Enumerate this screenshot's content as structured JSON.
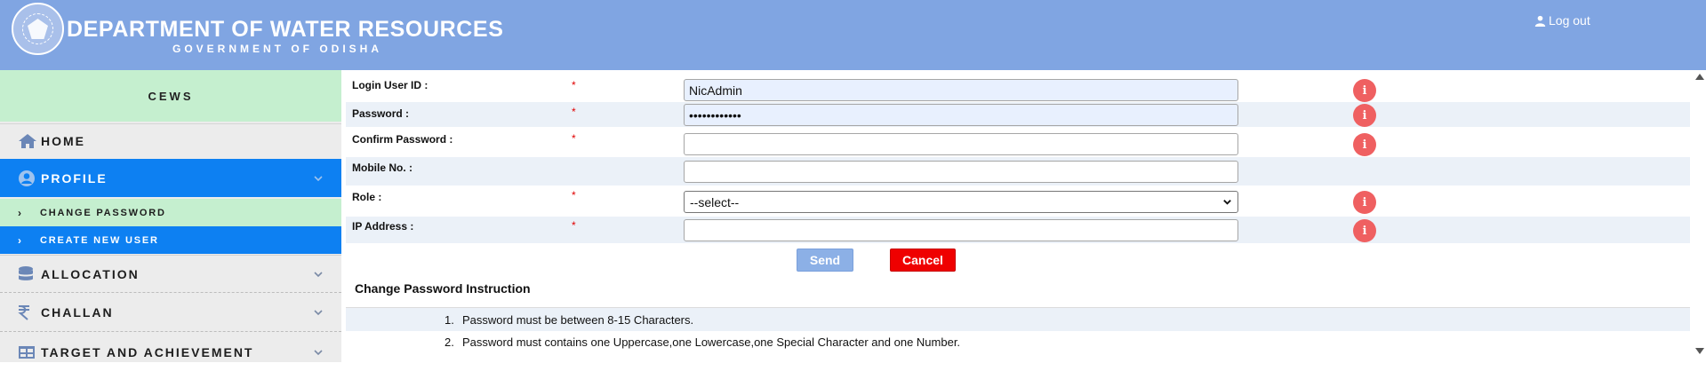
{
  "header": {
    "title": "DEPARTMENT OF WATER RESOURCES",
    "subtitle": "GOVERNMENT OF ODISHA",
    "logout_label": "Log out"
  },
  "sidebar": {
    "brand": "CEWS",
    "items": [
      {
        "label": "HOME",
        "icon": "home-icon"
      },
      {
        "label": "PROFILE",
        "icon": "user-circle-icon",
        "active": true
      },
      {
        "label": "ALLOCATION",
        "icon": "database-icon"
      },
      {
        "label": "CHALLAN",
        "icon": "rupee-icon"
      },
      {
        "label": "TARGET AND ACHIEVEMENT",
        "icon": "table-icon"
      }
    ],
    "profile_sub": [
      {
        "arrow": "›",
        "label": "CHANGE PASSWORD"
      },
      {
        "arrow": "›",
        "label": "CREATE NEW USER"
      }
    ]
  },
  "form": {
    "fields": [
      {
        "label": "Login User ID :",
        "required": "*",
        "value": "NicAdmin"
      },
      {
        "label": "Password :",
        "required": "*",
        "value": "••••••••••••"
      },
      {
        "label": "Confirm Password :",
        "required": "*",
        "value": ""
      },
      {
        "label": "Mobile No. :",
        "required": "",
        "value": ""
      },
      {
        "label": "Role :",
        "required": "*",
        "value": "--select--"
      },
      {
        "label": "IP Address :",
        "required": "*",
        "value": ""
      }
    ],
    "info_glyph": "i",
    "send_label": "Send",
    "cancel_label": "Cancel"
  },
  "instructions": {
    "title": "Change Password Instruction",
    "items": [
      {
        "num": "1.",
        "text": "Password must be between 8-15 Characters."
      },
      {
        "num": "2.",
        "text": "Password must contains one Uppercase,one Lowercase,one Special Character and one Number."
      }
    ]
  },
  "colors": {
    "header_bg": "#80a5e2",
    "accent_blue": "#0d80f2",
    "accent_green": "#c5efcf",
    "danger": "#ef0000",
    "info": "#ef6061"
  }
}
